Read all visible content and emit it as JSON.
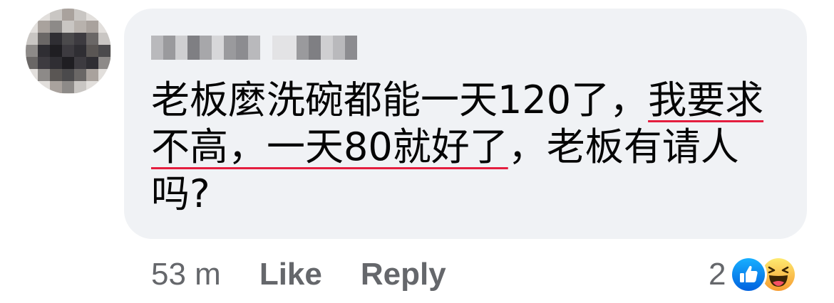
{
  "comment": {
    "author_name_visible": false,
    "text_plain_start": "老板麼洗碗都能一天120了，",
    "text_underlined": "我要求不高，一天80就好了",
    "text_plain_end": "，老板有请人吗?",
    "underline_color": "#e41e3f",
    "bubble_color": "#f0f2f5",
    "text_color": "#050505"
  },
  "footer": {
    "time": "53 m",
    "like_label": "Like",
    "reply_label": "Reply",
    "text_color": "#65676b"
  },
  "reactions": {
    "count": "2",
    "icons": [
      "like-reaction-icon",
      "haha-reaction-icon"
    ],
    "like_color": "#1877f2"
  }
}
